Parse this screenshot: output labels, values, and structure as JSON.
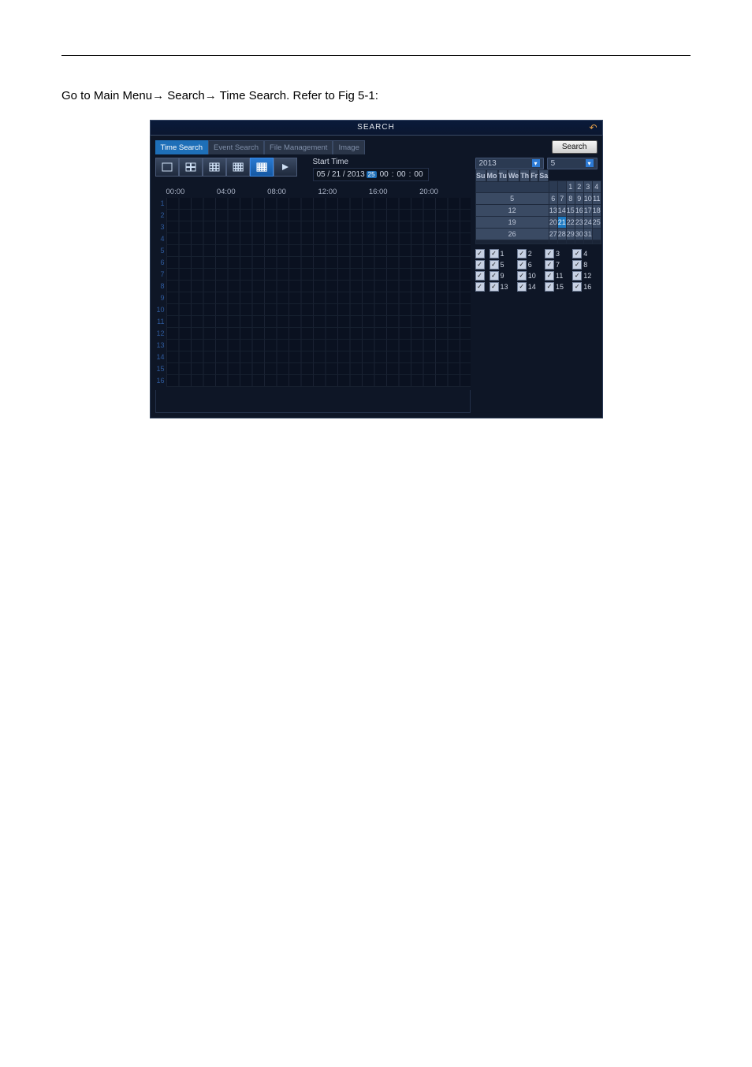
{
  "navSteps": {
    "step1": "Main Menu",
    "step2": "Search",
    "step3": "Time Search."
  },
  "narrative1": "Go to ",
  "narrative2": " Refer to Fig 5-1:",
  "window": {
    "title": "SEARCH",
    "tabs": [
      "Time Search",
      "Event Search",
      "File Management",
      "Image"
    ],
    "activeTab": 0,
    "searchButton": "Search",
    "startTimeLabel": "Start Time",
    "startDate": "05 / 21 / 2013",
    "startDateIcon": "25",
    "startTime": [
      "00",
      "00",
      "00"
    ],
    "timeHeaders": [
      "00:00",
      "04:00",
      "08:00",
      "12:00",
      "16:00",
      "20:00"
    ],
    "rowNrs": [
      "1",
      "2",
      "3",
      "4",
      "5",
      "6",
      "7",
      "8",
      "9",
      "10",
      "11",
      "12",
      "13",
      "14",
      "15",
      "16"
    ],
    "yearSel": "2013",
    "monthSel": "5",
    "dow": [
      "Su",
      "Mo",
      "Tu",
      "We",
      "Th",
      "Fr",
      "Sa"
    ],
    "calWeeks": [
      [
        "",
        "",
        "",
        "1",
        "2",
        "3",
        "4"
      ],
      [
        "5",
        "6",
        "7",
        "8",
        "9",
        "10",
        "11"
      ],
      [
        "12",
        "13",
        "14",
        "15",
        "16",
        "17",
        "18"
      ],
      [
        "19",
        "20",
        "21",
        "22",
        "23",
        "24",
        "25"
      ],
      [
        "26",
        "27",
        "28",
        "29",
        "30",
        "31",
        ""
      ],
      [
        "",
        "",
        "",
        "",
        "",
        "",
        ""
      ]
    ],
    "calSelected": "21",
    "channels": [
      [
        "1",
        "2",
        "3",
        "4"
      ],
      [
        "5",
        "6",
        "7",
        "8"
      ],
      [
        "9",
        "10",
        "11",
        "12"
      ],
      [
        "13",
        "14",
        "15",
        "16"
      ]
    ]
  }
}
